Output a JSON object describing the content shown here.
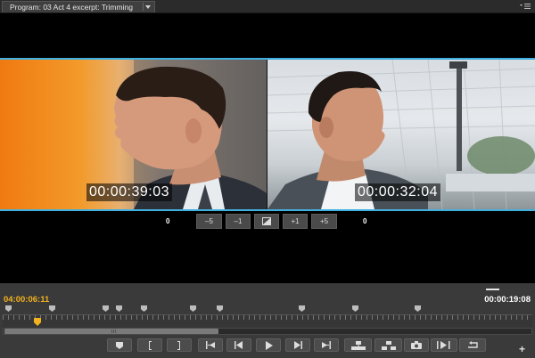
{
  "window": {
    "tab_label": "Program: 03 Act 4 excerpt: Trimming"
  },
  "monitor": {
    "left_timecode": "00:00:39:03",
    "right_timecode": "00:00:32:04",
    "left_offset": "0",
    "right_offset": "0",
    "trim_buttons": [
      "–5",
      "–1",
      "",
      "+1",
      "+5"
    ]
  },
  "timeline": {
    "current_timecode": "04:00:06:11",
    "duration_timecode": "00:00:19:08"
  },
  "colors": {
    "accent_blue": "#3fb0e0",
    "playhead_yellow": "#f2b21e"
  }
}
